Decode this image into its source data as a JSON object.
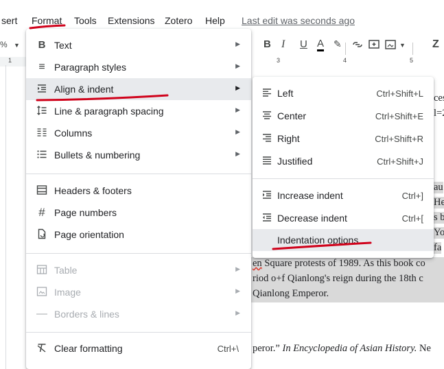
{
  "menubar": {
    "items": [
      "sert",
      "Format",
      "Tools",
      "Extensions",
      "Zotero",
      "Help"
    ],
    "last_edit": "Last edit was seconds ago"
  },
  "toolbar": {
    "bold": "B",
    "italic": "I",
    "underline": "U",
    "text_color": "A",
    "zoom_partial": "Z"
  },
  "ruler": {
    "labels": [
      "1",
      "3",
      "4",
      "5"
    ]
  },
  "format_menu": {
    "items": [
      {
        "label": "Text",
        "icon": "bold-icon",
        "has_submenu": true
      },
      {
        "label": "Paragraph styles",
        "icon": "paragraph-styles-icon",
        "has_submenu": true
      },
      {
        "label": "Align & indent",
        "icon": "align-indent-icon",
        "has_submenu": true,
        "active": true
      },
      {
        "label": "Line & paragraph spacing",
        "icon": "line-spacing-icon",
        "has_submenu": true
      },
      {
        "label": "Columns",
        "icon": "columns-icon",
        "has_submenu": true
      },
      {
        "label": "Bullets & numbering",
        "icon": "bullets-icon",
        "has_submenu": true
      },
      {
        "label": "Headers & footers",
        "icon": "headers-footers-icon"
      },
      {
        "label": "Page numbers",
        "icon": "hash-icon"
      },
      {
        "label": "Page orientation",
        "icon": "page-orientation-icon"
      },
      {
        "label": "Table",
        "icon": "table-icon",
        "has_submenu": true,
        "disabled": true
      },
      {
        "label": "Image",
        "icon": "image-icon",
        "has_submenu": true,
        "disabled": true
      },
      {
        "label": "Borders & lines",
        "icon": "borders-icon",
        "has_submenu": true,
        "disabled": true
      },
      {
        "label": "Clear formatting",
        "icon": "clear-formatting-icon",
        "shortcut": "Ctrl+\\"
      }
    ]
  },
  "align_submenu": {
    "items": [
      {
        "label": "Left",
        "shortcut": "Ctrl+Shift+L",
        "icon": "align-left-icon"
      },
      {
        "label": "Center",
        "shortcut": "Ctrl+Shift+E",
        "icon": "align-center-icon"
      },
      {
        "label": "Right",
        "shortcut": "Ctrl+Shift+R",
        "icon": "align-right-icon"
      },
      {
        "label": "Justified",
        "shortcut": "Ctrl+Shift+J",
        "icon": "align-justify-icon"
      },
      {
        "label": "Increase indent",
        "shortcut": "Ctrl+]",
        "icon": "increase-indent-icon"
      },
      {
        "label": "Decrease indent",
        "shortcut": "Ctrl+[",
        "icon": "decrease-indent-icon"
      },
      {
        "label": "Indentation options",
        "shortcut": "",
        "icon": ""
      }
    ]
  },
  "document": {
    "fragments": [
      "ces",
      "l=2",
      "au",
      "He",
      "s b",
      "Yo",
      "fa"
    ],
    "line1_pre": "en",
    "line1": " Square protests of 1989. As this book co",
    "line2": "riod o+f Qianlong's reign during the 18th c",
    "line3": "Qianlong Emperor.",
    "ref_pre": "peror.” ",
    "ref_italic": "In Encyclopedia of Asian History.",
    "ref_post": " Ne"
  },
  "colors": {
    "annotation_red": "#d0021b",
    "active_bg": "#e8eaed"
  }
}
